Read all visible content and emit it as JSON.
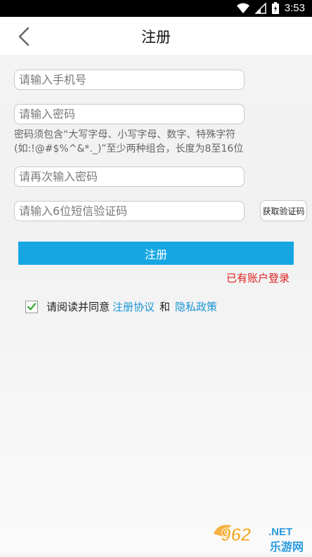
{
  "status_bar": {
    "time": "3:53",
    "icons": [
      "wifi-icon",
      "signal-icon",
      "battery-icon"
    ]
  },
  "header": {
    "title": "注册",
    "back_icon": "chevron-left-icon"
  },
  "form": {
    "phone_placeholder": "请输入手机号",
    "password_placeholder": "请输入密码",
    "password_hint": "密码须包含“大写字母、小写字母、数字、特殊字符(如:!@#$%^&*._)”至少两种组合，长度为8至16位",
    "confirm_placeholder": "请再次输入密码",
    "sms_placeholder": "请输入6位短信验证码",
    "get_code_label": "获取验证码",
    "submit_label": "注册",
    "login_link": "已有账户登录"
  },
  "agreement": {
    "checked": true,
    "prefix": "请阅读并同意",
    "register_agreement": "注册协议",
    "and": "和",
    "privacy_policy": "隐私政策"
  },
  "watermark": {
    "number": "962",
    "suffix": ".NET",
    "site_name": "乐游网"
  },
  "colors": {
    "accent": "#16a6e2",
    "link": "#1895d6",
    "login_link": "#e02020",
    "check": "#3cae3c"
  }
}
